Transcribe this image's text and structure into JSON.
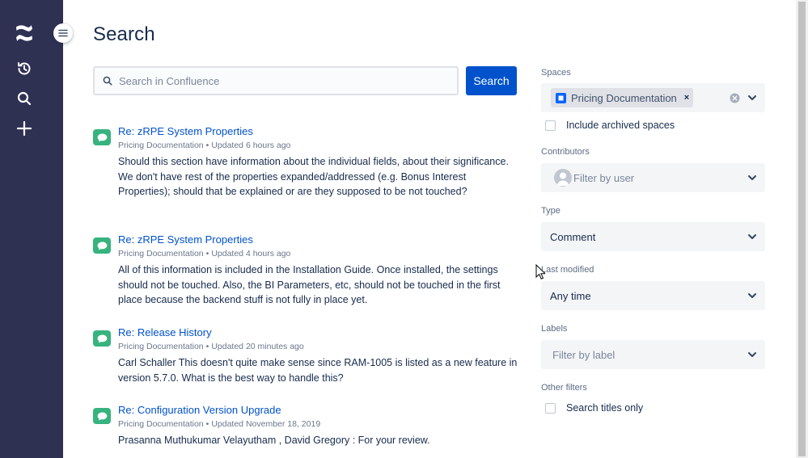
{
  "page": {
    "title": "Search"
  },
  "search": {
    "placeholder": "Search in Confluence",
    "value": "",
    "button_label": "Search"
  },
  "results": [
    {
      "title": "Re: zRPE System Properties",
      "space": "Pricing Documentation",
      "updated": "Updated 6 hours ago",
      "excerpt": "Should this section have information about the individual fields, about their significance. We don't have rest of the properties expanded/addressed (e.g. Bonus Interest Properties); should that be explained or are they supposed to be not touched?"
    },
    {
      "title": "Re: zRPE System Properties",
      "space": "Pricing Documentation",
      "updated": "Updated 4 hours ago",
      "excerpt": "All of this information is included in the Installation Guide. Once installed, the settings should not be touched. Also, the BI Parameters, etc, should not be touched in the first place because the backend stuff is not fully in place yet."
    },
    {
      "title": "Re: Release History",
      "space": "Pricing Documentation",
      "updated": "Updated 20 minutes ago",
      "excerpt": "Carl Schaller This doesn't quite make sense since RAM-1005 is listed as a new feature in version 5.7.0. What is the best way to handle this?"
    },
    {
      "title": "Re: Configuration Version Upgrade",
      "space": "Pricing Documentation",
      "updated": "Updated November 18, 2019",
      "excerpt": "Prasanna Muthukumar Velayutham , David Gregory : For your review."
    }
  ],
  "filters": {
    "spaces": {
      "label": "Spaces",
      "selected": "Pricing Documentation",
      "remove": "×",
      "archived_label": "Include archived spaces"
    },
    "contributors": {
      "label": "Contributors",
      "placeholder": "Filter by user"
    },
    "type": {
      "label": "Type",
      "value": "Comment"
    },
    "last_modified": {
      "label": "Last modified",
      "value": "Any time"
    },
    "labels": {
      "label": "Labels",
      "placeholder": "Filter by label"
    },
    "other": {
      "label": "Other filters",
      "titles_only_label": "Search titles only"
    }
  },
  "colors": {
    "nav_bg": "#2f3153",
    "primary": "#0052cc",
    "comment_icon": "#36b37e",
    "space_icon": "#0065ff"
  },
  "icons": {
    "nav": [
      "confluence-logo-icon",
      "recent-history-icon",
      "search-icon",
      "create-plus-icon"
    ],
    "collapse": "menu-collapse-icon"
  }
}
